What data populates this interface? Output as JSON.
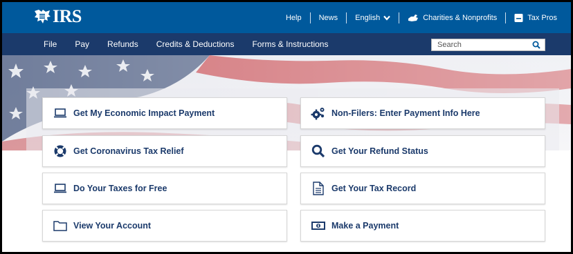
{
  "logo": {
    "text": "IRS"
  },
  "utility": {
    "help": "Help",
    "news": "News",
    "language": "English",
    "charities": "Charities & Nonprofits",
    "tax_pros": "Tax Pros"
  },
  "nav": {
    "items": [
      "File",
      "Pay",
      "Refunds",
      "Credits & Deductions",
      "Forms & Instructions"
    ]
  },
  "search": {
    "placeholder": "Search"
  },
  "tiles": [
    {
      "label": "Get My Economic Impact Payment",
      "icon": "laptop-icon"
    },
    {
      "label": "Non-Filers: Enter Payment Info Here",
      "icon": "gears-icon"
    },
    {
      "label": "Get Coronavirus Tax Relief",
      "icon": "lifebuoy-icon"
    },
    {
      "label": "Get Your Refund Status",
      "icon": "magnifier-icon"
    },
    {
      "label": "Do Your Taxes for Free",
      "icon": "laptop-icon"
    },
    {
      "label": "Get Your Tax Record",
      "icon": "document-icon"
    },
    {
      "label": "View Your Account",
      "icon": "folder-icon"
    },
    {
      "label": "Make a Payment",
      "icon": "money-icon"
    }
  ],
  "colors": {
    "topbar": "#00599c",
    "navbar": "#1b3a6b",
    "tile_text": "#1b3a6b"
  }
}
